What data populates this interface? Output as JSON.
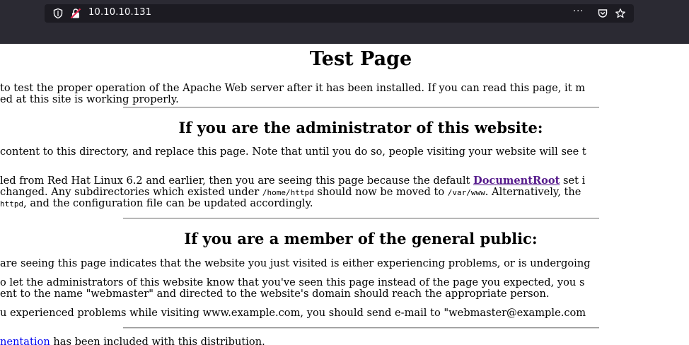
{
  "browser": {
    "url": "10.10.10.131",
    "more_label": "···"
  },
  "page": {
    "title": "Test Page",
    "intro": [
      "to test the proper operation of the Apache Web server after it has been installed. If you can read this page, it m",
      "ed at this site is working properly."
    ],
    "admin_heading": "If you are the administrator of this website:",
    "admin_p1": "content to this directory, and replace this page. Note that until you do so, people visiting your website will see t",
    "admin_p2_l1_pre": "led from Red Hat Linux 6.2 and earlier, then you are seeing this page because the default ",
    "admin_p2_link": "DocumentRoot",
    "admin_p2_l1_post": " set i",
    "admin_p2_l2_a": " changed. Any subdirectories which existed under ",
    "admin_p2_l2_code1": "/home/httpd",
    "admin_p2_l2_b": " should now be moved to ",
    "admin_p2_l2_code2": "/var/www",
    "admin_p2_l2_c": ". Alternatively, the",
    "admin_p2_l3_code": "httpd",
    "admin_p2_l3_rest": ", and the configuration file can be updated accordingly.",
    "public_heading": "If you are a member of the general public:",
    "public_p1": "are seeing this page indicates that the website you just visited is either experiencing problems, or is undergoing",
    "public_p2": [
      "o let the administrators of this website know that you've seen this page instead of the page you expected, you s",
      "ent to the name \"webmaster\" and directed to the website's domain should reach the appropriate person."
    ],
    "public_p3": "u experienced problems while visiting www.example.com, you should send e-mail to \"webmaster@example.com",
    "doc_link": "nentation",
    "doc_rest": " has been included with this distribution."
  }
}
